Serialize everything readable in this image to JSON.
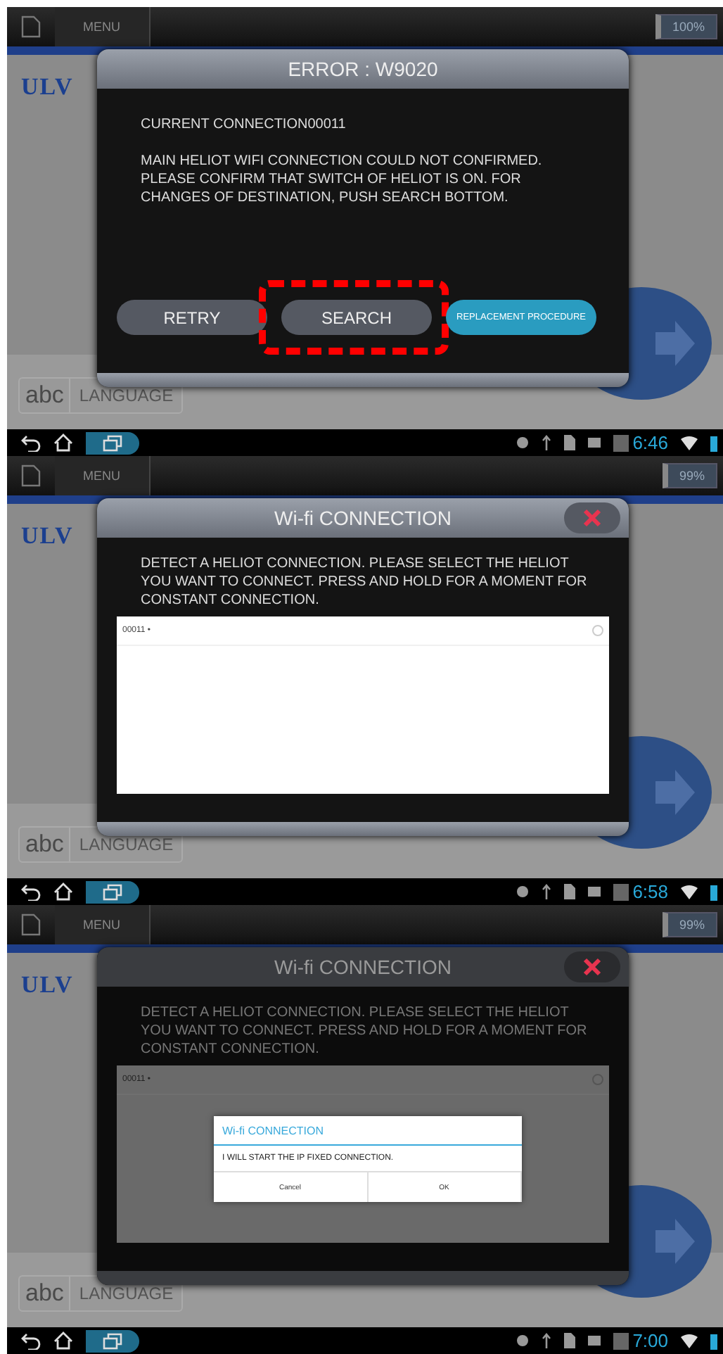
{
  "screens": [
    {
      "top_bar": {
        "menu": "MENU",
        "battery": "100%"
      },
      "logo": "ULV",
      "language": {
        "icon": "abc",
        "label": "LANGUAGE"
      },
      "dialog": {
        "kind": "error",
        "title": "ERROR : W9020",
        "current": "CURRENT CONNECTION00011",
        "message": "MAIN HELIOT WIFI CONNECTION COULD NOT CONFIRMED. PLEASE CONFIRM THAT SWITCH OF HELIOT IS ON. FOR CHANGES OF DESTINATION, PUSH SEARCH BOTTOM.",
        "buttons": [
          {
            "label": "RETRY",
            "kind": "plain",
            "highlighted": false
          },
          {
            "label": "SEARCH",
            "kind": "plain",
            "highlighted": true
          },
          {
            "label": "REPLACEMENT PROCEDURE",
            "kind": "primary",
            "highlighted": false
          }
        ]
      },
      "nav_bar": {
        "time": "6:46"
      }
    },
    {
      "top_bar": {
        "menu": "MENU",
        "battery": "99%"
      },
      "logo": "ULV",
      "language": {
        "icon": "abc",
        "label": "LANGUAGE"
      },
      "dialog": {
        "kind": "wifi",
        "title": "Wi-fi CONNECTION",
        "dimmed": false,
        "message": "DETECT A HELIOT CONNECTION. PLEASE SELECT THE HELIOT YOU WANT TO CONNECT. PRESS AND HOLD FOR A MOMENT FOR CONSTANT CONNECTION.",
        "networks": [
          {
            "name": "00011 •",
            "selected": false
          }
        ]
      },
      "nav_bar": {
        "time": "6:58"
      }
    },
    {
      "top_bar": {
        "menu": "MENU",
        "battery": "99%"
      },
      "logo": "ULV",
      "language": {
        "icon": "abc",
        "label": "LANGUAGE"
      },
      "dialog": {
        "kind": "wifi",
        "title": "Wi-fi CONNECTION",
        "dimmed": true,
        "message": "DETECT A HELIOT CONNECTION. PLEASE SELECT THE HELIOT YOU WANT TO CONNECT. PRESS AND HOLD FOR A MOMENT FOR CONSTANT CONNECTION.",
        "networks": [
          {
            "name": "00011 •",
            "selected": false
          }
        ]
      },
      "alert": {
        "title": "Wi-fi CONNECTION",
        "message": "I WILL START THE IP FIXED CONNECTION.",
        "buttons": [
          "Cancel",
          "OK"
        ]
      },
      "nav_bar": {
        "time": "7:00"
      }
    }
  ]
}
